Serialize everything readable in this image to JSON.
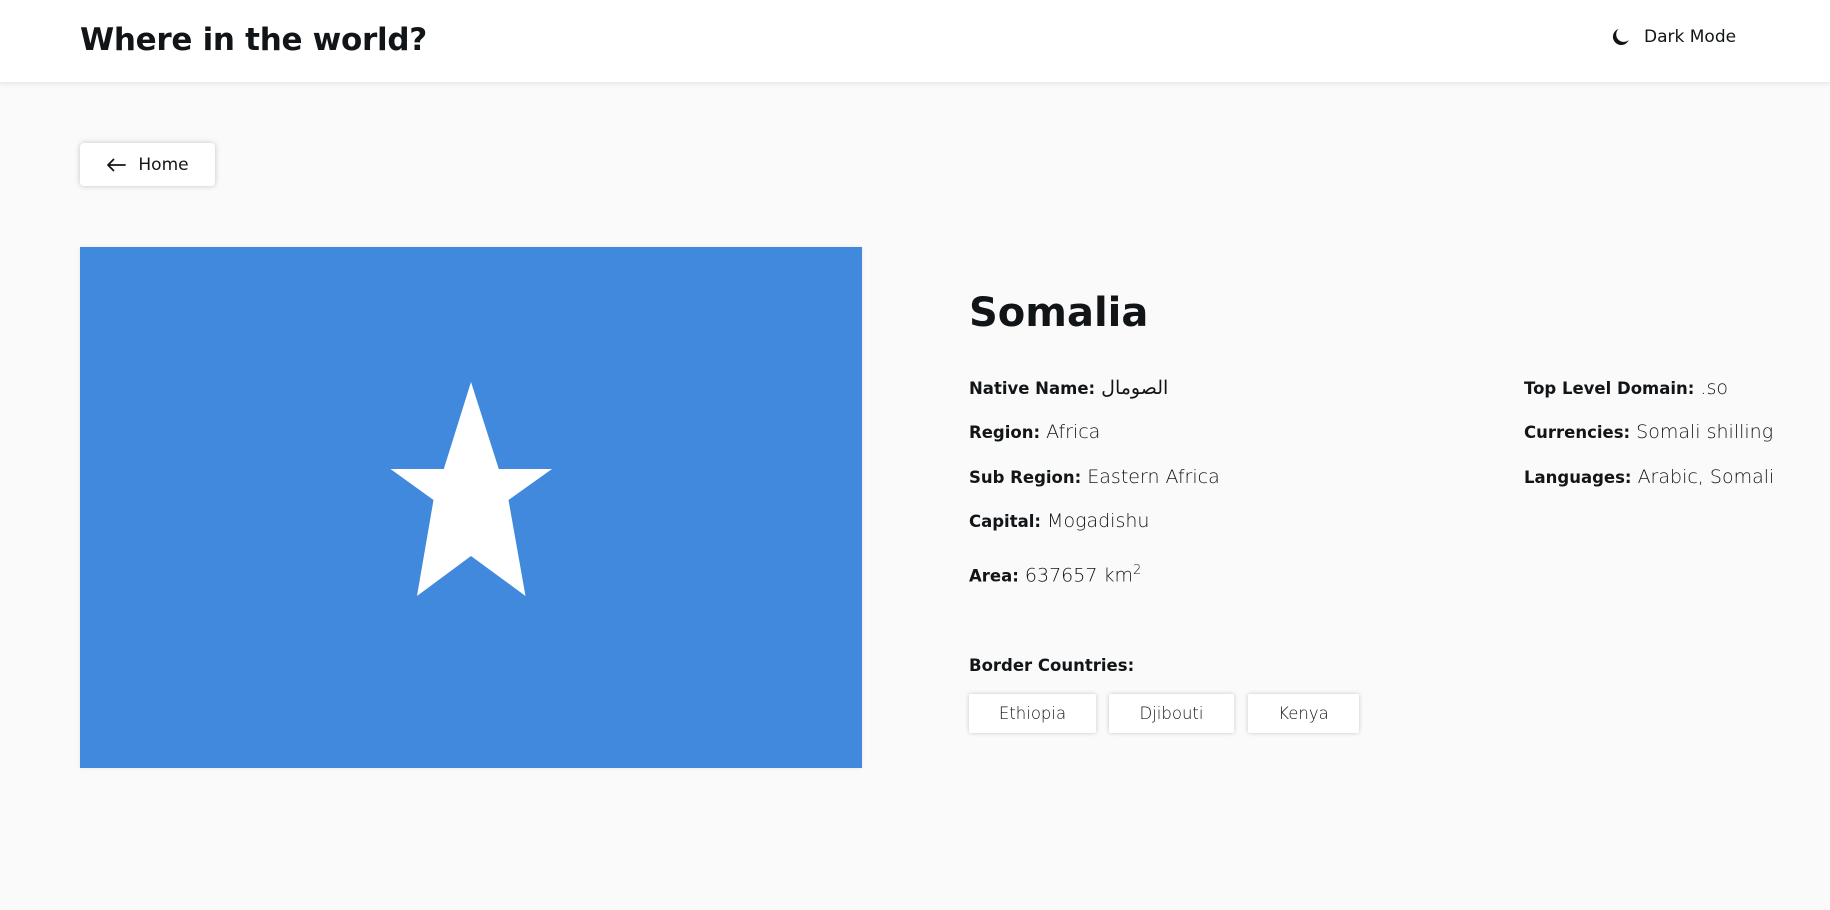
{
  "header": {
    "title": "Where in the world?",
    "mode_toggle": {
      "label": "Dark Mode",
      "icon": "moon-icon"
    }
  },
  "nav": {
    "back_label": "Home",
    "back_icon": "arrow-left-icon"
  },
  "country": {
    "name": "Somalia",
    "flag": {
      "background": "#4189dd",
      "star": "#ffffff"
    },
    "details_left": [
      {
        "label": "Native Name:",
        "value": "الصومال"
      },
      {
        "label": "Region:",
        "value": "Africa"
      },
      {
        "label": "Sub Region:",
        "value": "Eastern Africa"
      },
      {
        "label": "Capital:",
        "value": "Mogadishu"
      },
      {
        "label": "Area:",
        "value": "637657 km",
        "sup": "2"
      }
    ],
    "details_right": [
      {
        "label": "Top Level Domain:",
        "value": ".so"
      },
      {
        "label": "Currencies:",
        "value": "Somali shilling"
      },
      {
        "label": "Languages:",
        "value": "Arabic, Somali"
      }
    ],
    "border_label": "Border Countries:",
    "borders": [
      "Ethiopia",
      "Djibouti",
      "Kenya"
    ]
  },
  "colors": {
    "page_background": "#fafafa",
    "element_background": "#ffffff",
    "text": "#111517"
  }
}
